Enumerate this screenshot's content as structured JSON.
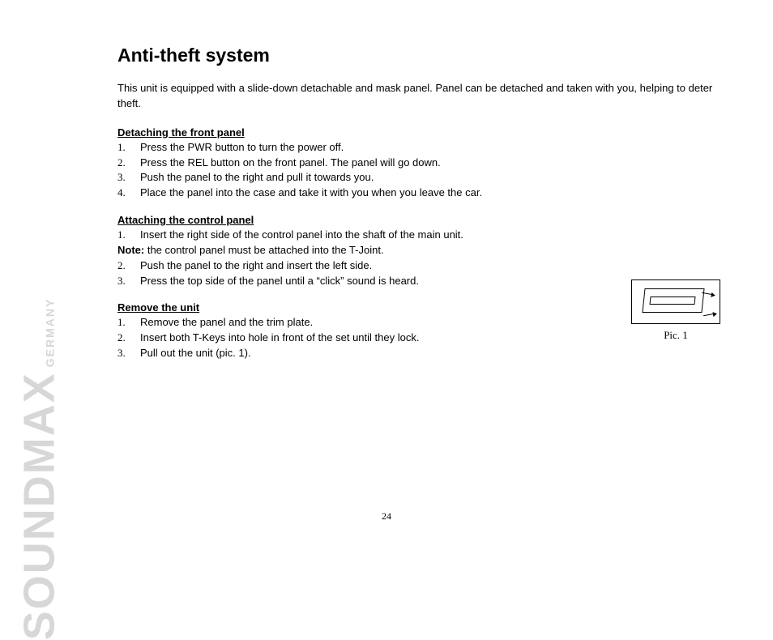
{
  "brand": {
    "main": "SOUNDMAX",
    "sub": "GERMANY"
  },
  "title": "Anti-theft system",
  "intro": "This unit is equipped with a slide-down detachable and mask panel. Panel can be detached and taken with you, helping to deter theft.",
  "sections": {
    "detach": {
      "heading": "Detaching the front panel",
      "steps": [
        "Press the PWR button to turn the power off.",
        "Press the REL button on the front panel. The panel will go down.",
        "Push the panel to the right and pull it towards you.",
        "Place the panel into the case and take it with you when you leave the car."
      ]
    },
    "attach": {
      "heading": "Attaching the control panel",
      "step1": "Insert the right side of the control panel into the shaft of the main unit.",
      "note_label": "Note:",
      "note_text": " the control panel must be attached into the T-Joint.",
      "step2": "Push the panel to the right and insert the left side.",
      "step3": "Press the top side of the panel until a “click” sound is heard."
    },
    "remove": {
      "heading": "Remove the unit",
      "steps": [
        "Remove the panel and the trim plate.",
        "Insert both T-Keys into hole in front of the set until they lock.",
        "Pull out the unit (pic. 1)."
      ]
    }
  },
  "figure": {
    "caption": "Pic. 1"
  },
  "page_number": "24",
  "numbers": {
    "n1": "1.",
    "n2": "2.",
    "n3": "3.",
    "n4": "4."
  }
}
